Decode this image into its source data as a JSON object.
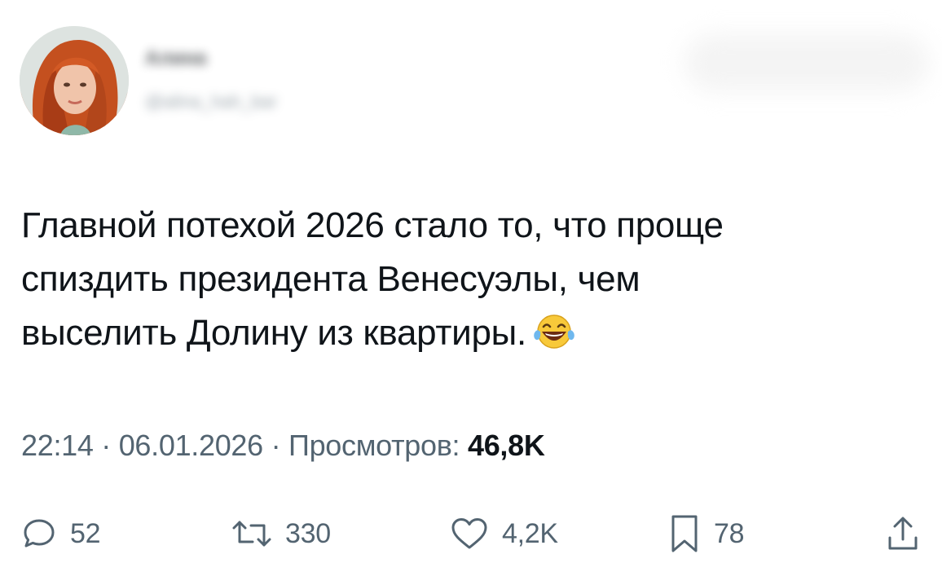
{
  "author": {
    "name": "Алина",
    "handle": "@alina_hah_bar"
  },
  "tweet": {
    "lines": [
      "Главной потехой 2026 стало то, что проще",
      "спиздить президента Венесуэлы, чем",
      "выселить Долину из квартиры."
    ],
    "emoji": "face-with-tears-of-joy"
  },
  "meta": {
    "time": "22:14",
    "separator": "·",
    "date": "06.01.2026",
    "views_label": "Просмотров:",
    "views_count": "46,8K"
  },
  "actions": {
    "replies": "52",
    "retweets": "330",
    "likes": "4,2K",
    "bookmarks": "78"
  },
  "colors": {
    "text": "#0f1419",
    "secondary": "#536471"
  }
}
